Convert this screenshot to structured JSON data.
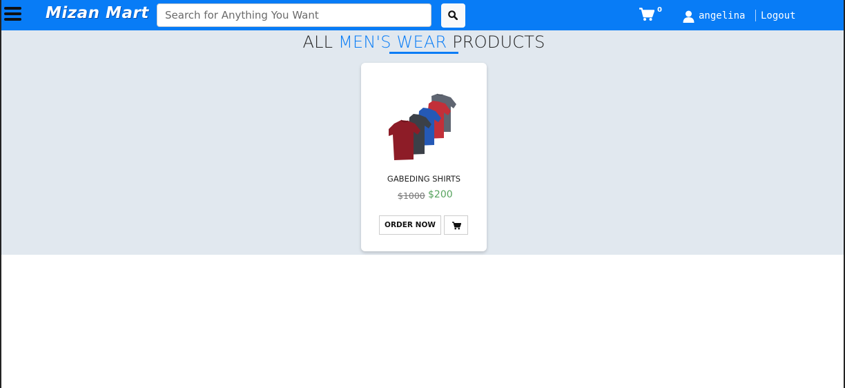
{
  "header": {
    "brand": "Mizan Mart",
    "search": {
      "placeholder": "Search for Anything You Want",
      "value": ""
    },
    "cart_count": "0",
    "username": "angelina",
    "logout_label": "Logout"
  },
  "icons": {
    "menu": "hamburger-menu-icon",
    "search": "search-icon",
    "cart": "shopping-cart-icon",
    "user": "user-icon",
    "add_to_cart": "add-to-cart-icon"
  },
  "page": {
    "heading_prefix": "ALL",
    "heading_highlight": "MEN'S WEAR",
    "heading_suffix": "PRODUCTS"
  },
  "products": [
    {
      "name": "GABEDING SHIRTS",
      "old_price": "$1000",
      "new_price": "$200",
      "order_label": "ORDER NOW",
      "image": "stack-of-tshirts"
    }
  ],
  "colors": {
    "primary": "#087cf6",
    "section_bg": "#e1e8ef",
    "price_green": "#57a35e"
  }
}
